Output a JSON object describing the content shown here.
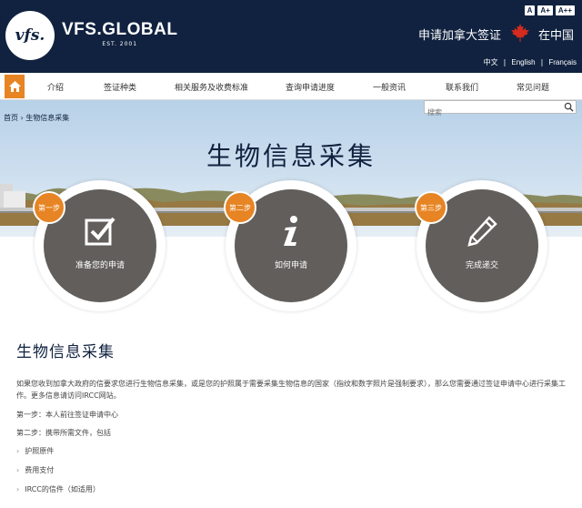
{
  "header": {
    "logo_text": "vfs.",
    "brand_name": "VFS.GLOBAL",
    "brand_est": "EST. 2001",
    "font_sizes": [
      "A",
      "A+",
      "A++"
    ],
    "apply_title": "申请加拿大签证",
    "country": "在中国",
    "languages": [
      "中文",
      "English",
      "Français"
    ]
  },
  "nav": {
    "items": [
      "介绍",
      "签证种类",
      "相关服务及收费标准",
      "查询申请进度",
      "一般资讯",
      "联系我们",
      "常见问题"
    ]
  },
  "breadcrumb": {
    "home": "首页",
    "separator": "›",
    "current": "生物信息采集"
  },
  "search": {
    "placeholder": "搜索"
  },
  "hero": {
    "title": "生物信息采集",
    "steps": [
      {
        "badge": "第一步",
        "label": "准备您的申请",
        "icon": "checkbox-icon"
      },
      {
        "badge": "第二步",
        "label": "如何申请",
        "icon": "info-icon"
      },
      {
        "badge": "第三步",
        "label": "完成递交",
        "icon": "pencil-icon"
      }
    ]
  },
  "content": {
    "title": "生物信息采集",
    "intro": "如果您收到加拿大政府的信要求您进行生物信息采集，或是您的护照属于需要采集生物信息的国家（指纹和数字照片是强制要求），那么您需要通过签证申请中心进行采集工作。更多信息请访问IRCC网站。",
    "step1": "第一步：本人前往签证申请中心",
    "step2": "第二步：携带所需文件，包括",
    "documents": [
      "护照原件",
      "费用支付",
      "IRCC的信件（如适用）"
    ]
  },
  "colors": {
    "header_bg": "#10223f",
    "accent": "#e78423",
    "step_circle": "#615e5b",
    "maple": "#d52b1e"
  }
}
